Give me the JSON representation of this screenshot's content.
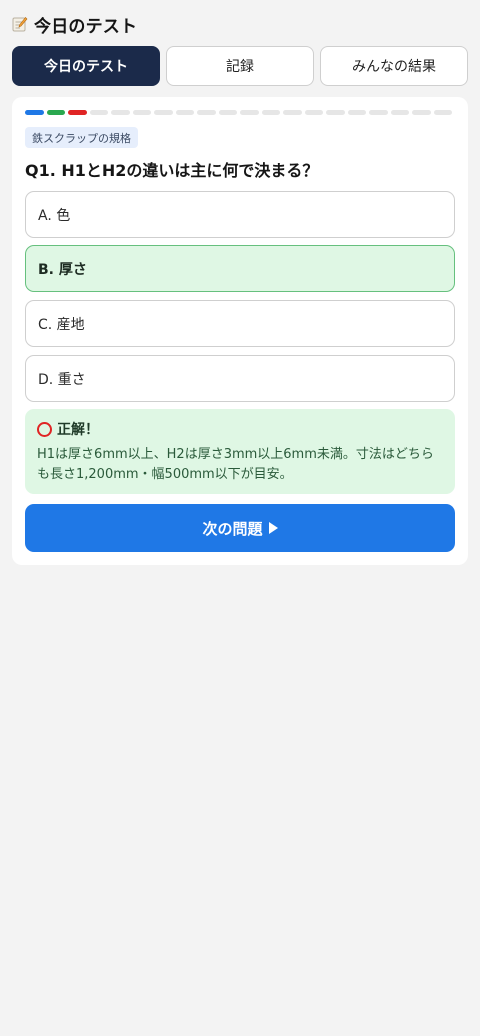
{
  "header": {
    "icon": "memo-icon",
    "title": "今日のテスト"
  },
  "tabs": [
    {
      "label": "今日のテスト",
      "active": true
    },
    {
      "label": "記録",
      "active": false
    },
    {
      "label": "みんなの結果",
      "active": false
    }
  ],
  "progress": {
    "total": 20,
    "segments": [
      "#1f78e6",
      "#2aa84f",
      "#e02424"
    ]
  },
  "quiz": {
    "category": "鉄スクラップの規格",
    "question": "Q1. H1とH2の違いは主に何で決まる？",
    "options": [
      {
        "label": "A. 色",
        "correct": false
      },
      {
        "label": "B. 厚さ",
        "correct": true
      },
      {
        "label": "C. 産地",
        "correct": false
      },
      {
        "label": "D. 重さ",
        "correct": false
      }
    ],
    "result": {
      "icon": "circle-icon",
      "title": "正解！",
      "explanation": "H1は厚さ6mm以上、H2は厚さ3mm以上6mm未満。寸法はどちらも長さ1,200mm・幅500mm以下が目安。"
    },
    "next_label": "次の問題"
  }
}
